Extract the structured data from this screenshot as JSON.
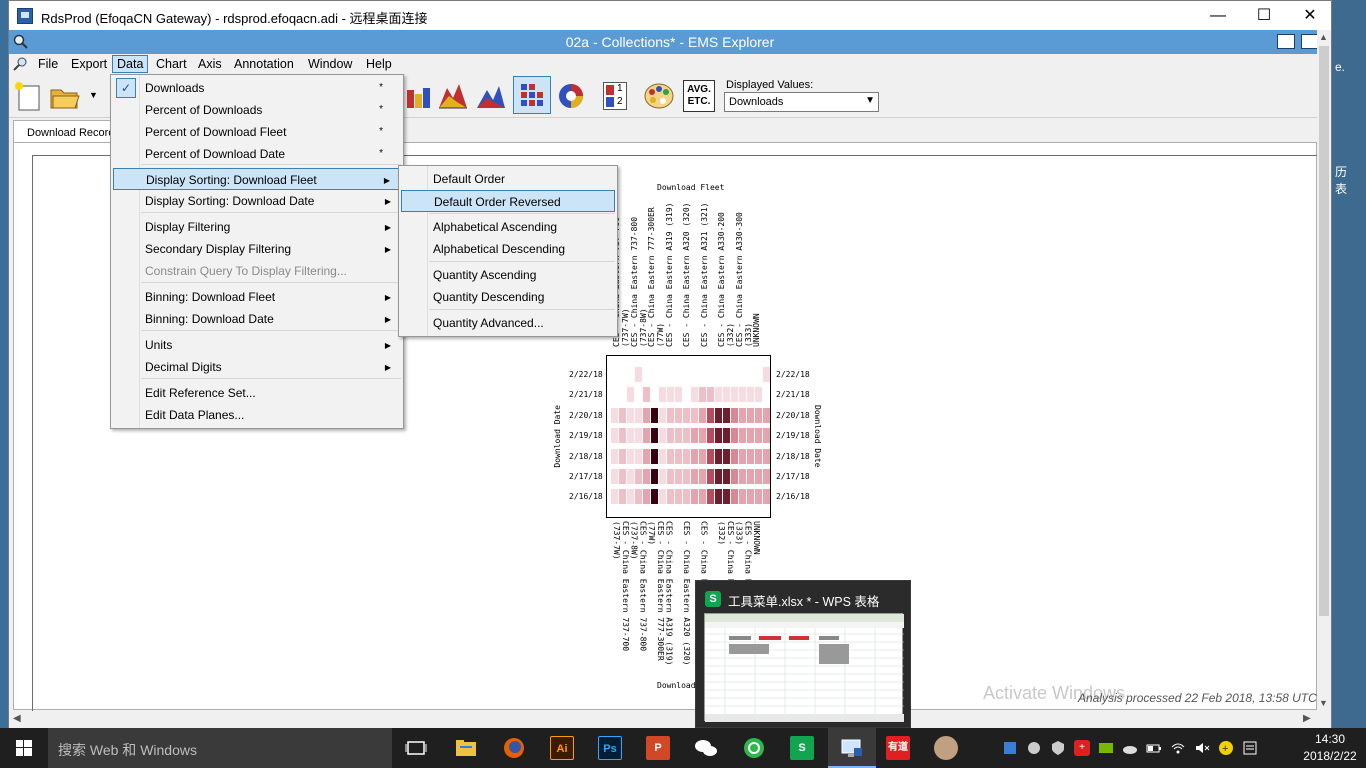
{
  "rdp": {
    "title": "RdsProd (EfoqaCN Gateway) - rdsprod.efoqacn.adi - 远程桌面连接",
    "minimize": "—",
    "maximize": "☐",
    "close": "✕",
    "right_fragments": [
      "e.",
      "历",
      "表"
    ]
  },
  "app": {
    "title": "02a - Collections* - EMS Explorer",
    "menus": [
      "File",
      "Export",
      "Data",
      "Chart",
      "Axis",
      "Annotation",
      "Window",
      "Help"
    ],
    "active_menu": "Data",
    "toolbar": {
      "displayed_values_label": "Displayed Values:",
      "displayed_values_value": "Downloads",
      "avg_label_1": "AVG.",
      "avg_label_2": "ETC.",
      "num_1": "1",
      "num_2": "2"
    },
    "tab": "Download Record",
    "analysis_text": "Analysis processed 22 Feb 2018, 13:58 UTC",
    "activate_windows": "Activate Windows"
  },
  "data_menu": {
    "items": [
      {
        "label": "Downloads",
        "checked": true,
        "star": "*"
      },
      {
        "label": "Percent of Downloads",
        "star": "*"
      },
      {
        "label": "Percent of Download Fleet",
        "star": "*"
      },
      {
        "label": "Percent of Download Date",
        "star": "*"
      },
      {
        "label": "Display Sorting: Download Fleet",
        "submenu": true,
        "highlighted": true
      },
      {
        "label": "Display Sorting: Download Date",
        "submenu": true
      },
      {
        "label": "Display Filtering",
        "submenu": true
      },
      {
        "label": "Secondary Display Filtering",
        "submenu": true
      },
      {
        "label": "Constrain Query To Display Filtering...",
        "disabled": true
      },
      {
        "label": "Binning: Download Fleet",
        "submenu": true
      },
      {
        "label": "Binning: Download Date",
        "submenu": true
      },
      {
        "label": "Units",
        "submenu": true
      },
      {
        "label": "Decimal Digits",
        "submenu": true
      },
      {
        "label": "Edit Reference Set..."
      },
      {
        "label": "Edit Data Planes..."
      }
    ]
  },
  "sort_submenu": {
    "items": [
      {
        "label": "Default Order"
      },
      {
        "label": "Default Order Reversed",
        "highlighted": true
      },
      {
        "label": "Alphabetical Ascending"
      },
      {
        "label": "Alphabetical Descending"
      },
      {
        "label": "Quantity Ascending"
      },
      {
        "label": "Quantity Descending"
      },
      {
        "label": "Quantity Advanced..."
      }
    ]
  },
  "chart": {
    "top_axis_title": "Download Fleet",
    "bottom_axis_title": "Download",
    "left_axis_title": "Download Date",
    "right_axis_title": "Download Date",
    "dates": [
      "2/22/18",
      "2/21/18",
      "2/20/18",
      "2/19/18",
      "2/18/18",
      "2/17/18",
      "2/16/18"
    ],
    "top_fleet_labels": [
      "CES - China Eastern 737-700 (737-7W)",
      "CES - China Eastern 737-800 (737-8W)",
      "CES - China Eastern 777-300ER (77W)",
      "CES - China Eastern A319 (319)",
      "CES - China Eastern A320 (320)",
      "CES - China Eastern A321 (321)",
      "CES - China Eastern A330-200 (332)",
      "CES - China Eastern A330-300 (333)",
      "UNKNOWN"
    ]
  },
  "chart_data": {
    "type": "heatmap",
    "title": "",
    "xlabel": "Download Fleet",
    "ylabel": "Download Date",
    "rows": [
      "2/22/18",
      "2/21/18",
      "2/20/18",
      "2/19/18",
      "2/18/18",
      "2/17/18",
      "2/16/18"
    ],
    "columns": 20,
    "values": [
      [
        0,
        0,
        0,
        1,
        0,
        0,
        0,
        0,
        0,
        0,
        0,
        0,
        0,
        0,
        0,
        0,
        0,
        0,
        0,
        1
      ],
      [
        0,
        0,
        1,
        0,
        2,
        0,
        1,
        1,
        1,
        0,
        1,
        2,
        2,
        1,
        1,
        1,
        1,
        1,
        1,
        0
      ],
      [
        1,
        2,
        1,
        1,
        3,
        9,
        1,
        2,
        2,
        2,
        2,
        3,
        6,
        8,
        8,
        4,
        3,
        3,
        3,
        3
      ],
      [
        1,
        2,
        1,
        1,
        3,
        9,
        1,
        2,
        2,
        2,
        3,
        3,
        6,
        8,
        8,
        4,
        3,
        3,
        3,
        3
      ],
      [
        1,
        2,
        1,
        1,
        3,
        9,
        1,
        2,
        2,
        2,
        3,
        3,
        6,
        8,
        8,
        4,
        3,
        3,
        3,
        3
      ],
      [
        1,
        2,
        1,
        2,
        3,
        9,
        1,
        2,
        2,
        2,
        3,
        3,
        6,
        8,
        8,
        4,
        3,
        3,
        3,
        3
      ],
      [
        1,
        2,
        1,
        2,
        3,
        9,
        1,
        2,
        2,
        2,
        3,
        3,
        6,
        8,
        8,
        4,
        3,
        3,
        3,
        3
      ]
    ]
  },
  "taskbar": {
    "search_placeholder": "搜索 Web 和 Windows",
    "time": "14:30",
    "date": "2018/2/22",
    "youdao": "有道"
  },
  "preview": {
    "title": "工具菜单.xlsx * - WPS 表格",
    "icon_letter": "S"
  }
}
